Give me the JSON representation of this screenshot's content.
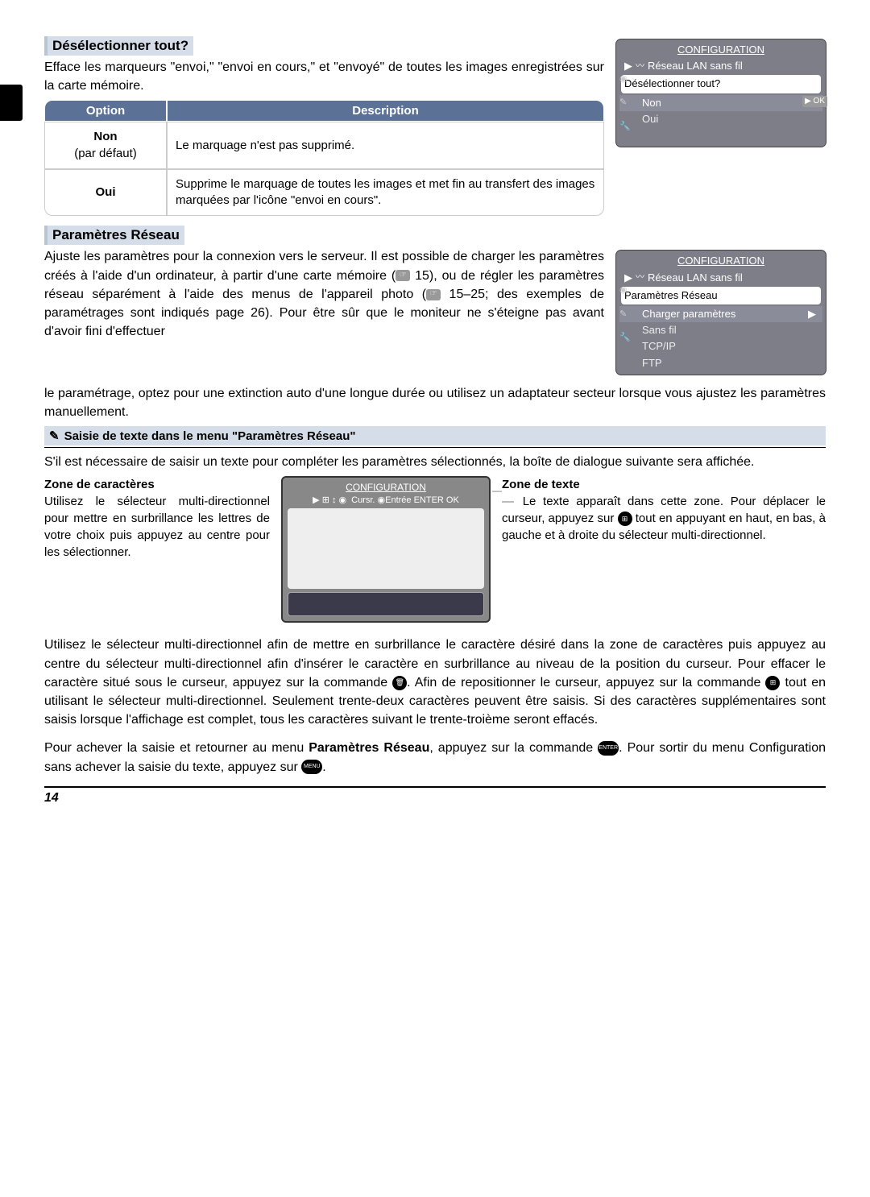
{
  "sections": {
    "deselect": {
      "title": "Désélectionner tout?",
      "body": "Efface les marqueurs \"envoi,\" \"envoi en cours,\" et \"envoyé\" de toutes les images enregistrées sur la carte mémoire.",
      "table": {
        "h1": "Option",
        "h2": "Description",
        "r1_opt_bold": "Non",
        "r1_opt_sub": "(par défaut)",
        "r1_desc": "Le marquage n'est pas supprimé.",
        "r2_opt": "Oui",
        "r2_desc": "Supprime le marquage de toutes les images et met fin au transfert des images marquées par l'icône \"envoi en cours\"."
      }
    },
    "network": {
      "title": "Paramètres Réseau",
      "body1": "Ajuste les paramètres pour la connexion vers le serveur. Il est possible de charger les paramètres créés à l'aide d'un ordinateur, à partir d'une carte mémoire (",
      "body1_ref": "15), ou de régler les paramètres réseau séparément à l'aide des menus de l'appareil photo (",
      "body1_ref2": "15–25; des exemples de paramétrages sont indiqués page 26). Pour être sûr que le moniteur ne s'éteigne pas avant d'avoir fini d'effectuer",
      "body2": "le paramétrage, optez pour une extinction auto d'une longue durée ou utilisez un adaptateur secteur lorsque vous ajustez les paramètres manuellement."
    },
    "note": {
      "title": "Saisie de texte dans le menu \"Paramètres Réseau\"",
      "intro": "S'il est nécessaire de saisir un texte pour compléter les paramètres sélectionnés, la boîte de dialogue suivante sera affichée.",
      "zone_char_title": "Zone de caractères",
      "zone_char_body": "Utilisez le sélecteur multi-directionnel pour mettre en surbrillance les lettres de votre choix puis appuyez au centre pour les sélectionner.",
      "zone_text_title": "Zone de texte",
      "zone_text_body_a": "Le texte apparaît dans cette zone. Pour déplacer le curseur, appuyez sur ",
      "zone_text_body_b": " tout en appuyant en haut, en bas, à gauche et à droite du sélecteur multi-directionnel.",
      "body3": "Utilisez le sélecteur multi-directionnel afin de mettre en surbrillance le caractère désiré dans la zone de caractères puis appuyez au centre du sélecteur multi-directionnel afin d'insérer le caractère en surbrillance au niveau de la position du curseur. Pour effacer le caractère situé sous le curseur, appuyez sur la commande ",
      "body3b": ". Afin de repositionner le curseur, appuyez sur la commande ",
      "body3c": " tout en utilisant le sélecteur multi-directionnel. Seulement trente-deux caractères peuvent être saisis. Si des caractères supplémentaires sont saisis lorsque l'affichage est complet, tous les caractères suivant le trente-troième seront effacés.",
      "body4a": "Pour achever la saisie et retourner au menu ",
      "body4_bold": "Paramètres Réseau",
      "body4b": ", appuyez sur la commande ",
      "body4c": ". Pour sortir du menu Configuration sans achever la saisie du texte, appuyez sur ",
      "body4d": "."
    }
  },
  "menu1": {
    "config": "CONFIGURATION",
    "sub": "Réseau LAN sans fil",
    "inner": "Désélectionner tout?",
    "non": "Non",
    "ok": "▶ OK",
    "oui": "Oui"
  },
  "menu2": {
    "config": "CONFIGURATION",
    "sub": "Réseau LAN sans fil",
    "inner": "Paramètres Réseau",
    "i1": "Charger paramètres",
    "i2": "Sans fil",
    "i3": "TCP/IP",
    "i4": "FTP"
  },
  "entry": {
    "config": "CONFIGURATION",
    "hint": "Cursr.  ◉Entrée  ENTER OK"
  },
  "page_number": "14",
  "icons": {
    "pencil": "✎",
    "trash": "🗑",
    "enter": "ENTER",
    "menu": "MENU",
    "thumb": "⊞"
  }
}
